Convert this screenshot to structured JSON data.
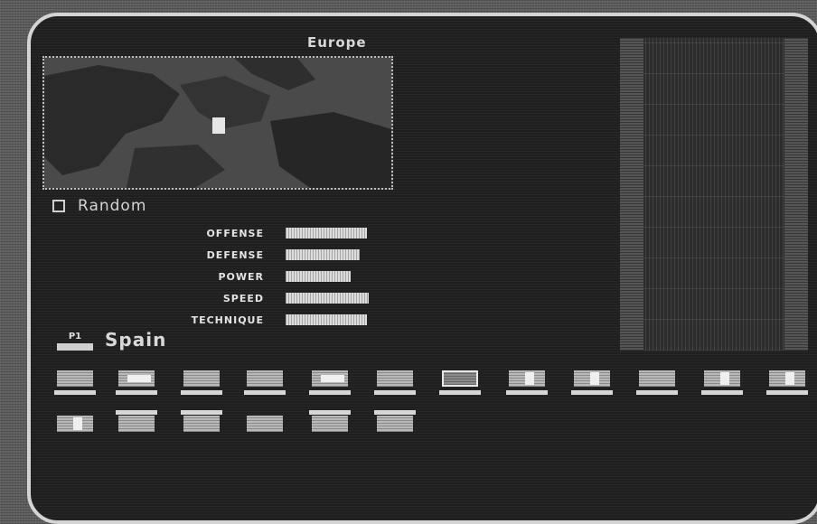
{
  "header": {
    "region": "Europe"
  },
  "mode": {
    "label": "Random"
  },
  "stats": [
    {
      "label": "OFFENSE",
      "value": 0.9
    },
    {
      "label": "DEFENSE",
      "value": 0.82
    },
    {
      "label": "POWER",
      "value": 0.72
    },
    {
      "label": "SPEED",
      "value": 0.92
    },
    {
      "label": "TECHNIQUE",
      "value": 0.9
    }
  ],
  "team": {
    "player": "P1",
    "name": "Spain"
  },
  "colors": {
    "frame": "#d4d4d4",
    "panel": "#1f1f1f",
    "bar": "#dcdcdc"
  }
}
